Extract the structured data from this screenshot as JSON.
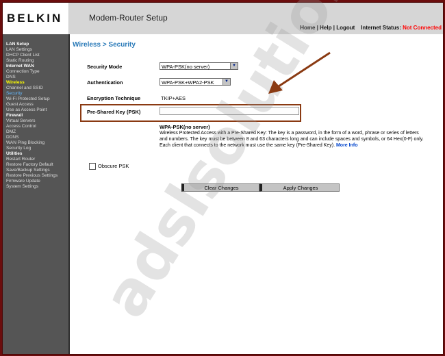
{
  "header": {
    "logo": "BELKIN",
    "title": "Modem-Router Setup",
    "nav": {
      "home": "Home",
      "sep": "|",
      "help": "Help",
      "logout": "Logout",
      "status_label": "Internet Status:",
      "status_value": "Not Connected"
    }
  },
  "sidebar": {
    "sections": [
      {
        "title": "LAN Setup",
        "items": [
          "LAN Settings",
          "DHCP Client List",
          "Static Routing"
        ]
      },
      {
        "title": "Internet WAN",
        "items": [
          "Connection Type",
          "DNS"
        ]
      },
      {
        "title": "Wireless",
        "items": [
          "Channel and SSID",
          "Security",
          "Wi-Fi Protected Setup",
          "Guest Access",
          "Use as Access Point"
        ]
      },
      {
        "title": "Firewall",
        "items": [
          "Virtual Servers",
          "Access Control",
          "DMZ",
          "DDNS",
          "WAN Ping Blocking",
          "Security Log"
        ]
      },
      {
        "title": "Utilities",
        "items": [
          "Restart Router",
          "Restore Factory Default",
          "Save/Backup Settings",
          "Restore Previous Settings",
          "Firmware Update",
          "System Settings"
        ]
      }
    ]
  },
  "main": {
    "title": "Wireless > Security",
    "security_mode": {
      "label": "Security Mode",
      "value": "WPA-PSK(no server)"
    },
    "authentication": {
      "label": "Authentication",
      "value": "WPA-PSK+WPA2-PSK"
    },
    "encryption": {
      "label": "Encryption Technique",
      "value": "TKIP+AES"
    },
    "psk": {
      "label": "Pre-Shared Key (PSK)",
      "value": ""
    },
    "help": {
      "title": "WPA-PSK(no server)",
      "body": "Wireless Protected Access with a Pre-Shared Key: The key is a password, in the form of a word, phrase or series of letters and numbers. The key must be between 8 and 63 characters long and can include spaces and symbols, or 64 Hex(0-F) only. Each client that connects to the network must use the same key (Pre-Shared Key).",
      "link": "More Info"
    },
    "obscure_psk": {
      "label": "Obscure PSK",
      "checked": false
    },
    "buttons": {
      "clear": "Clear Changes",
      "apply": "Apply Changes"
    }
  },
  "watermark": "adslsolution",
  "colors": {
    "frame": "#6b0d0d",
    "accent": "#2a7ab8",
    "status": "#ff0000",
    "sidebar_bg": "#555555",
    "sidebar_active_section": "#ffff00",
    "sidebar_active_item": "#66bbff",
    "annotation": "#8a3a12"
  }
}
